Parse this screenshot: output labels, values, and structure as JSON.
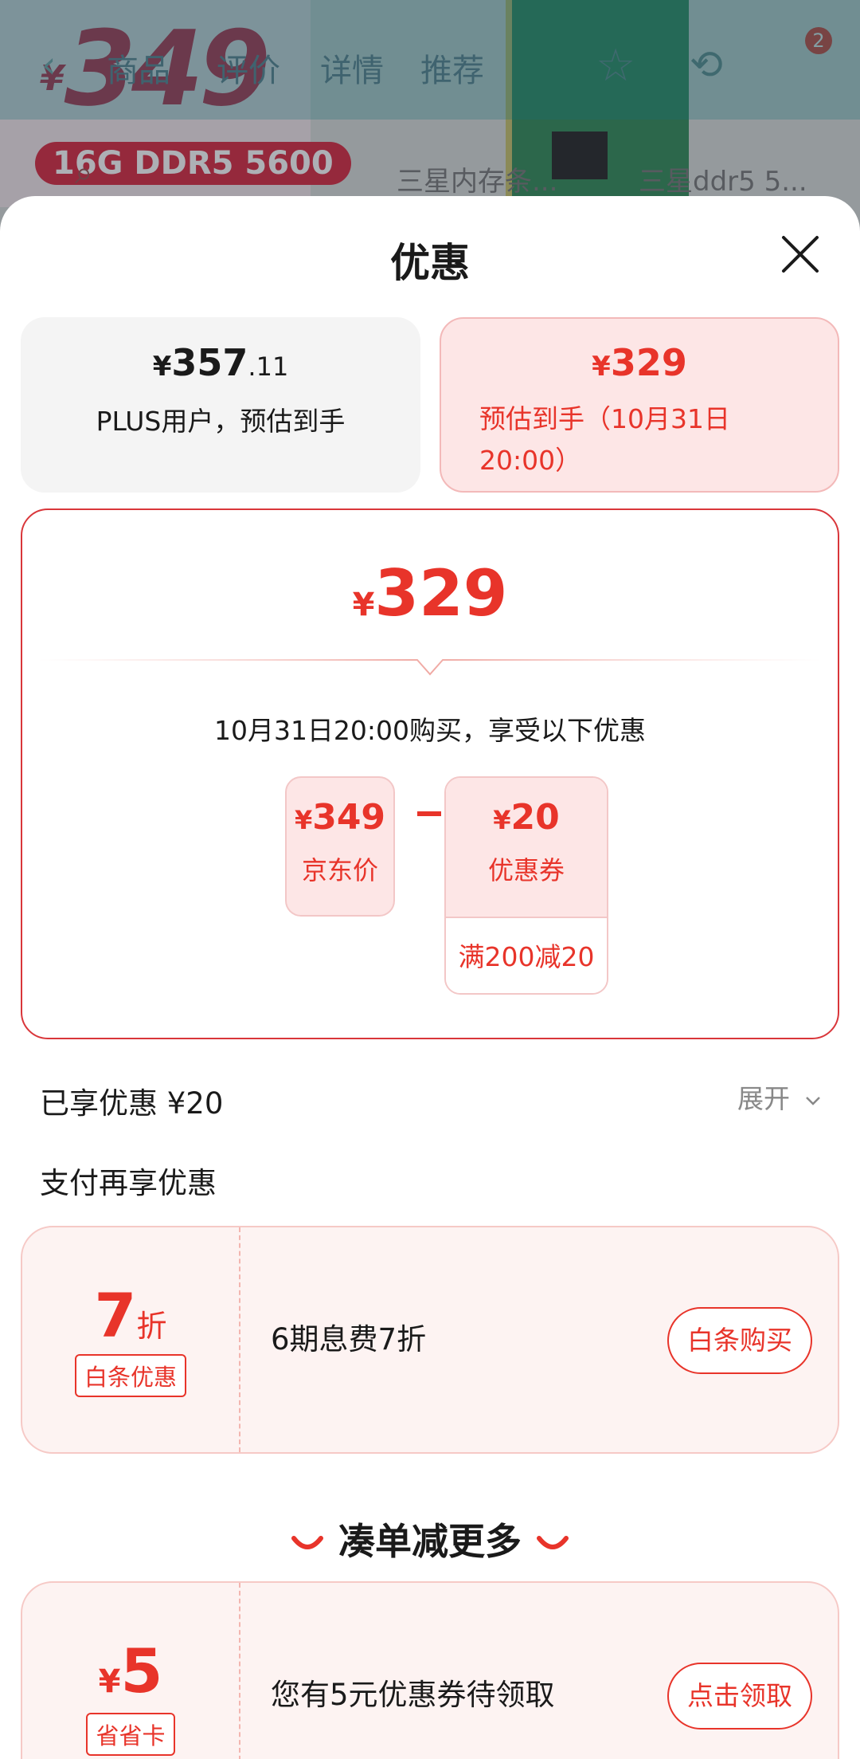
{
  "background": {
    "price_yen": "¥",
    "price": "349",
    "spec": "16G DDR5 5600",
    "nav_tabs": [
      "商品",
      "评价",
      "详情",
      "推荐"
    ],
    "cart_badge": "2",
    "sub_labels": [
      "三星内存条...",
      "三星ddr5 5..."
    ]
  },
  "sheet": {
    "title": "优惠",
    "options": {
      "plus": {
        "yen": "¥",
        "int": "357",
        "dec": ".11",
        "desc": "PLUS用户，预估到手"
      },
      "estimated": {
        "yen": "¥",
        "int": "329",
        "desc": "预估到手（10月31日20:00）"
      }
    },
    "detail": {
      "yen": "¥",
      "price": "329",
      "note": "10月31日20:00购买，享受以下优惠",
      "jd_price": {
        "yen": "¥",
        "value": "349",
        "label": "京东价"
      },
      "coupon": {
        "yen": "¥",
        "value": "20",
        "label": "优惠券",
        "condition": "满200减20"
      }
    },
    "enjoyed": "已享优惠 ¥20",
    "expand": "展开",
    "pay_more": "支付再享优惠",
    "baitiao": {
      "num": "7",
      "unit": "折",
      "tag": "白条优惠",
      "desc": "6期息费7折",
      "button": "白条购买"
    },
    "more_title": "凑单减更多",
    "coupon_card": {
      "yen": "¥",
      "num": "5",
      "tag": "省省卡",
      "desc": "您有5元优惠券待领取",
      "button": "点击领取"
    }
  },
  "colors": {
    "accent": "#e8342a",
    "accent_light": "#fde6e6",
    "border": "#d9363a"
  }
}
